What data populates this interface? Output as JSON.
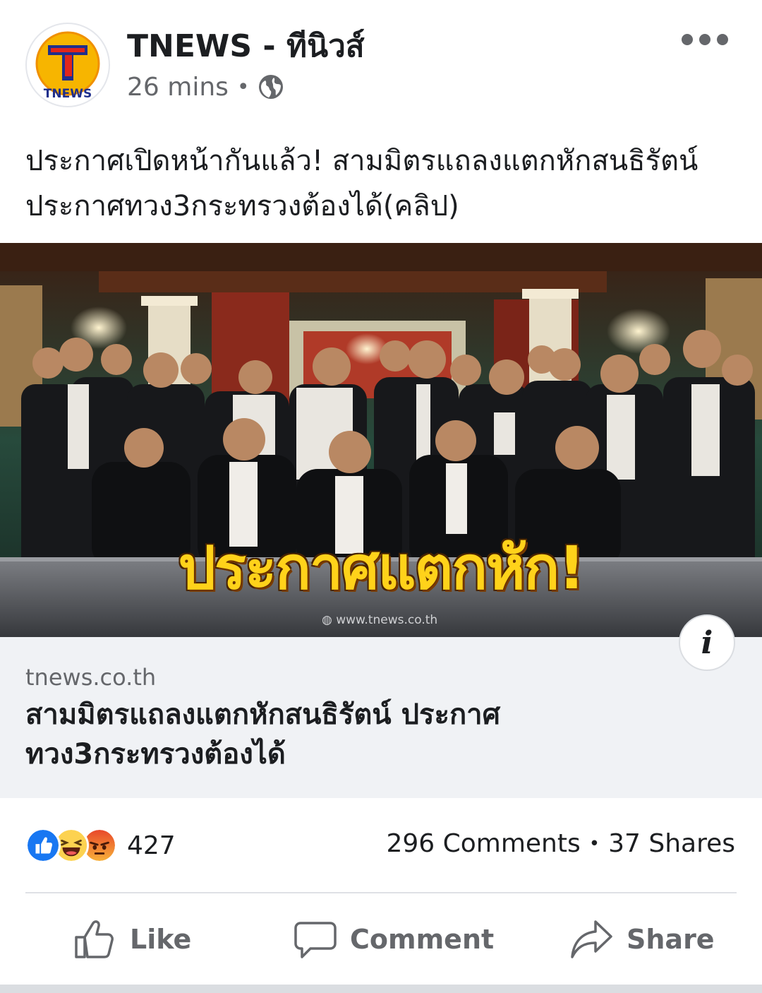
{
  "post": {
    "page_name": "TNEWS - ทีนิวส์",
    "time": "26 mins",
    "dot": "•",
    "avatar_logo_text": "TNEWS",
    "caption": "ประกาศเปิดหน้ากันแล้ว! สามมิตรแถลงแตกหักสนธิรัตน์ ประกาศทวง3กระทรวงต้องได้(คลิป)"
  },
  "preview": {
    "image_headline": "ประกาศแตกหัก!",
    "watermark": "www.tnews.co.th",
    "info_label": "i",
    "domain": "tnews.co.th",
    "title": "สามมิตรแถลงแตกหักสนธิรัตน์ ประกาศทวง3กระทรวงต้องได้"
  },
  "stats": {
    "reaction_count": "427",
    "reactions": [
      "like-icon",
      "haha-icon",
      "angry-icon"
    ],
    "comments": "296 Comments",
    "separator": "•",
    "shares": "37 Shares"
  },
  "actions": {
    "like": "Like",
    "comment": "Comment",
    "share": "Share"
  },
  "colors": {
    "text": "#1c1e21",
    "secondary": "#65676b",
    "link_bg": "#f0f2f5",
    "like_blue": "#1877f2",
    "headline_yellow": "#ffd21a"
  }
}
